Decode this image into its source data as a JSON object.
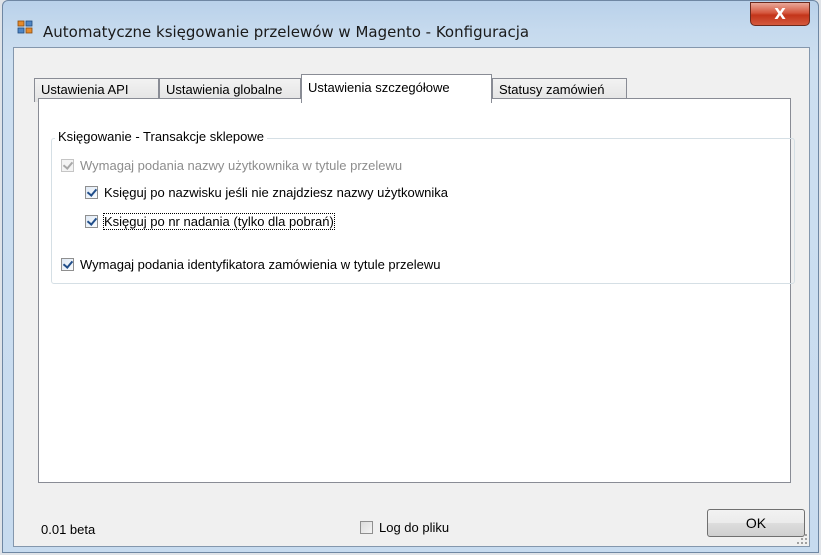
{
  "window": {
    "title": "Automatyczne księgowanie przelewów w Magento - Konfiguracja",
    "close_glyph": "X",
    "app_icon": "app-window-icon"
  },
  "tabs": [
    {
      "label": "Ustawienia API",
      "active": false
    },
    {
      "label": "Ustawienia globalne",
      "active": false
    },
    {
      "label": "Ustawienia szczegółowe",
      "active": true
    },
    {
      "label": "Statusy zamówień",
      "active": false
    }
  ],
  "group": {
    "title": "Księgowanie - Transakcje sklepowe",
    "options": [
      {
        "label": "Wymagaj podania nazwy użytkownika w tytule przelewu",
        "checked": true,
        "disabled": true
      },
      {
        "label": "Księguj po nazwisku jeśli nie znajdziesz nazwy użytkownika",
        "checked": true,
        "disabled": false
      },
      {
        "label": "Księguj po nr nadania (tylko dla pobrań)",
        "checked": true,
        "disabled": false
      },
      {
        "label": "Wymagaj podania identyfikatora zamówienia w tytule przelewu",
        "checked": true,
        "disabled": false
      }
    ]
  },
  "footer": {
    "version": "0.01 beta",
    "log_label": "Log do pliku",
    "log_checked": false,
    "ok_label": "OK"
  },
  "colors": {
    "title_gradient_top": "#b9d1ea",
    "close_red": "#c3341a",
    "check_blue": "#214e8a"
  }
}
